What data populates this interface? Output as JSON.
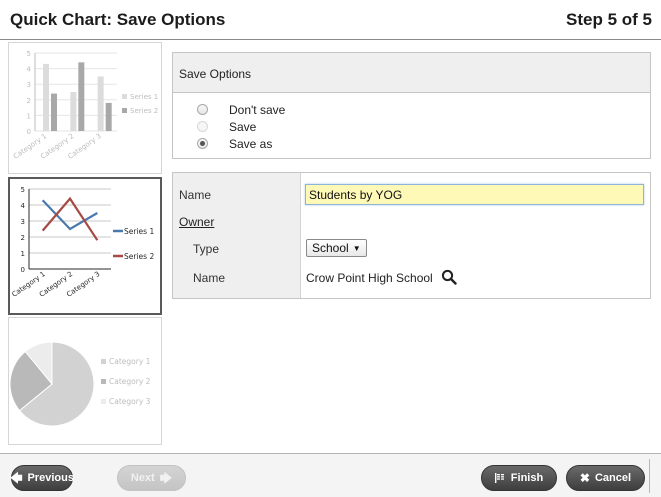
{
  "header": {
    "title": "Quick Chart: Save Options",
    "step": "Step 5 of 5"
  },
  "thumbnails": {
    "bar": {
      "y_ticks": [
        "5",
        "4",
        "3",
        "2",
        "1",
        "0"
      ],
      "categories": [
        "Category 1",
        "Category 2",
        "Category 3"
      ],
      "legend": [
        "Series 1",
        "Series 2"
      ],
      "colors": [
        "#dcdcdc",
        "#a8a8a8"
      ],
      "chart_data": {
        "type": "bar",
        "categories": [
          "Category 1",
          "Category 2",
          "Category 3"
        ],
        "ylim": [
          0,
          5
        ],
        "series": [
          {
            "name": "Series 1",
            "values": [
              4.3,
              2.5,
              3.5
            ]
          },
          {
            "name": "Series 2",
            "values": [
              2.4,
              4.4,
              1.8
            ]
          }
        ]
      }
    },
    "line": {
      "y_ticks": [
        "5",
        "4",
        "3",
        "2",
        "1",
        "0"
      ],
      "categories": [
        "Category 1",
        "Category 2",
        "Category 3"
      ],
      "legend": [
        "Series 1",
        "Series 2"
      ],
      "colors": [
        "#4a7aad",
        "#a54a45"
      ],
      "chart_data": {
        "type": "line",
        "categories": [
          "Category 1",
          "Category 2",
          "Category 3"
        ],
        "ylim": [
          0,
          5
        ],
        "series": [
          {
            "name": "Series 1",
            "values": [
              4.3,
              2.5,
              3.5
            ]
          },
          {
            "name": "Series 2",
            "values": [
              2.4,
              4.4,
              1.8
            ]
          }
        ]
      }
    },
    "pie": {
      "legend": [
        "Category 1",
        "Category 2",
        "Category 3"
      ],
      "colors": [
        "#d2d2d2",
        "#b9b9b9",
        "#ececec"
      ],
      "chart_data": {
        "type": "pie",
        "categories": [
          "Category 1",
          "Category 2",
          "Category 3"
        ],
        "values": [
          8.2,
          3.2,
          1.4
        ]
      }
    }
  },
  "save_options": {
    "heading": "Save Options",
    "options": [
      {
        "label": "Don't save",
        "checked": false,
        "disabled": false
      },
      {
        "label": "Save",
        "checked": false,
        "disabled": true
      },
      {
        "label": "Save as",
        "checked": true,
        "disabled": false
      }
    ]
  },
  "form": {
    "name_label": "Name",
    "name_value": "Students by YOG",
    "owner_label": "Owner",
    "type_label": "Type",
    "type_value": "School",
    "owner_name_label": "Name",
    "owner_name_value": "Crow Point High School"
  },
  "footer": {
    "previous": "Previous",
    "next": "Next",
    "finish": "Finish",
    "cancel": "Cancel"
  },
  "icons": {
    "previous": "arrow-left-icon",
    "next": "arrow-right-icon",
    "finish": "flag-icon",
    "cancel": "close-icon",
    "search": "magnifier-icon"
  }
}
